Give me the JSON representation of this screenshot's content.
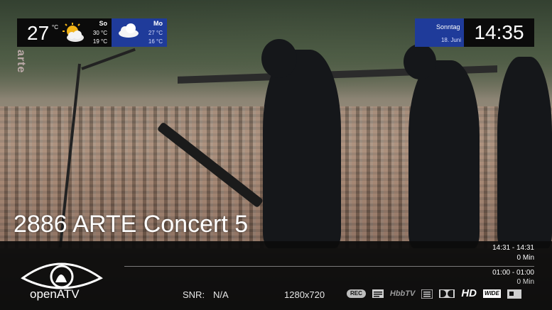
{
  "weather": {
    "current_temp": "27",
    "unit": "°C",
    "today": {
      "day": "So",
      "high": "30 °C",
      "low": "19 °C",
      "icon": "partly-sunny-icon"
    },
    "tomorrow": {
      "day": "Mo",
      "high": "27 °C",
      "low": "16 °C",
      "icon": "cloudy-icon"
    }
  },
  "clock": {
    "weekday": "Sonntag",
    "date": "18. Juni",
    "time": "14:35"
  },
  "channel": {
    "name": "2886 ARTE Concert 5"
  },
  "video": {
    "watermark": "arte"
  },
  "infobar": {
    "brand": "openATV",
    "now": {
      "time": "14:31  -  14:31",
      "duration": "0 Min"
    },
    "next": {
      "time": "01:00  -  01:00",
      "duration": "0 Min"
    },
    "progress": 0,
    "snr_label": "SNR:",
    "snr_value": "N/A",
    "resolution": "1280x720",
    "indicators": {
      "rec": "REC",
      "hbbtv": "HbbTV",
      "hd": "HD",
      "wide": "WIDE"
    }
  },
  "colors": {
    "accent_blue": "#1f3b9a",
    "panel_dark": "#0b0b0b"
  }
}
